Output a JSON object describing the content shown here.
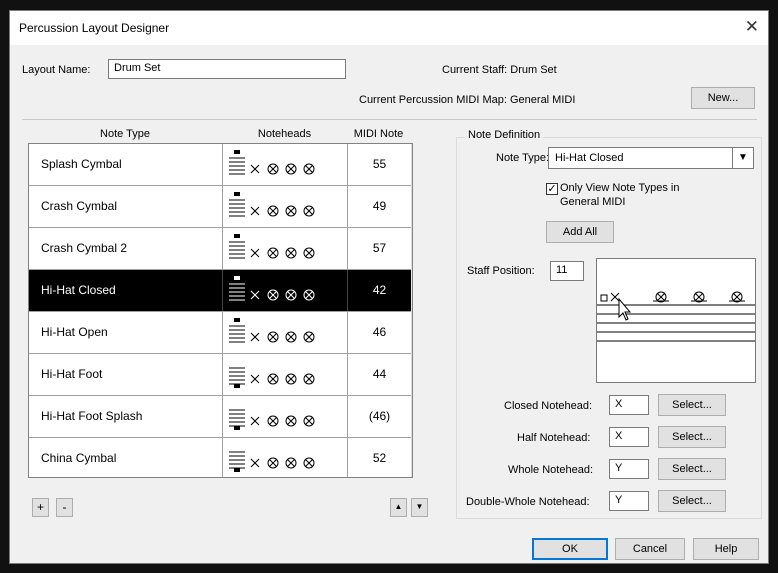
{
  "window": {
    "title": "Percussion Layout Designer"
  },
  "layout": {
    "name_label": "Layout Name:",
    "name_value": "Drum Set",
    "current_staff": "Current Staff: Drum Set",
    "current_midi_map": "Current Percussion MIDI Map: General MIDI",
    "new_button": "New..."
  },
  "table": {
    "headers": {
      "note_type": "Note Type",
      "noteheads": "Noteheads",
      "midi": "MIDI Note"
    },
    "rows": [
      {
        "name": "Splash Cymbal",
        "midi": "55",
        "staff_pos": "high",
        "selected": false
      },
      {
        "name": "Crash Cymbal",
        "midi": "49",
        "staff_pos": "high",
        "selected": false
      },
      {
        "name": "Crash Cymbal 2",
        "midi": "57",
        "staff_pos": "high",
        "selected": false
      },
      {
        "name": "Hi-Hat Closed",
        "midi": "42",
        "staff_pos": "high",
        "selected": true
      },
      {
        "name": "Hi-Hat Open",
        "midi": "46",
        "staff_pos": "high",
        "selected": false
      },
      {
        "name": "Hi-Hat Foot",
        "midi": "44",
        "staff_pos": "low",
        "selected": false
      },
      {
        "name": "Hi-Hat Foot Splash",
        "midi": "(46)",
        "staff_pos": "low",
        "selected": false
      },
      {
        "name": "China Cymbal",
        "midi": "52",
        "staff_pos": "low",
        "selected": false
      }
    ],
    "add_label": "+",
    "remove_label": "-"
  },
  "note_definition": {
    "group_title": "Note Definition",
    "note_type_label": "Note Type:",
    "note_type_value": "Hi-Hat Closed",
    "only_view_line1": "Only View Note Types in",
    "only_view_line2": "General MIDI",
    "only_view_checked": true,
    "add_all": "Add All",
    "staff_position_label": "Staff Position:",
    "staff_position_value": "11",
    "closed_label": "Closed Notehead:",
    "closed_value": "X",
    "half_label": "Half Notehead:",
    "half_value": "X",
    "whole_label": "Whole Notehead:",
    "whole_value": "Y",
    "double_label": "Double-Whole Notehead:",
    "double_value": "Y",
    "select_label": "Select..."
  },
  "footer": {
    "ok": "OK",
    "cancel": "Cancel",
    "help": "Help"
  },
  "colors": {
    "selected_row": "#000000",
    "default_button_border": "#0078d7"
  }
}
